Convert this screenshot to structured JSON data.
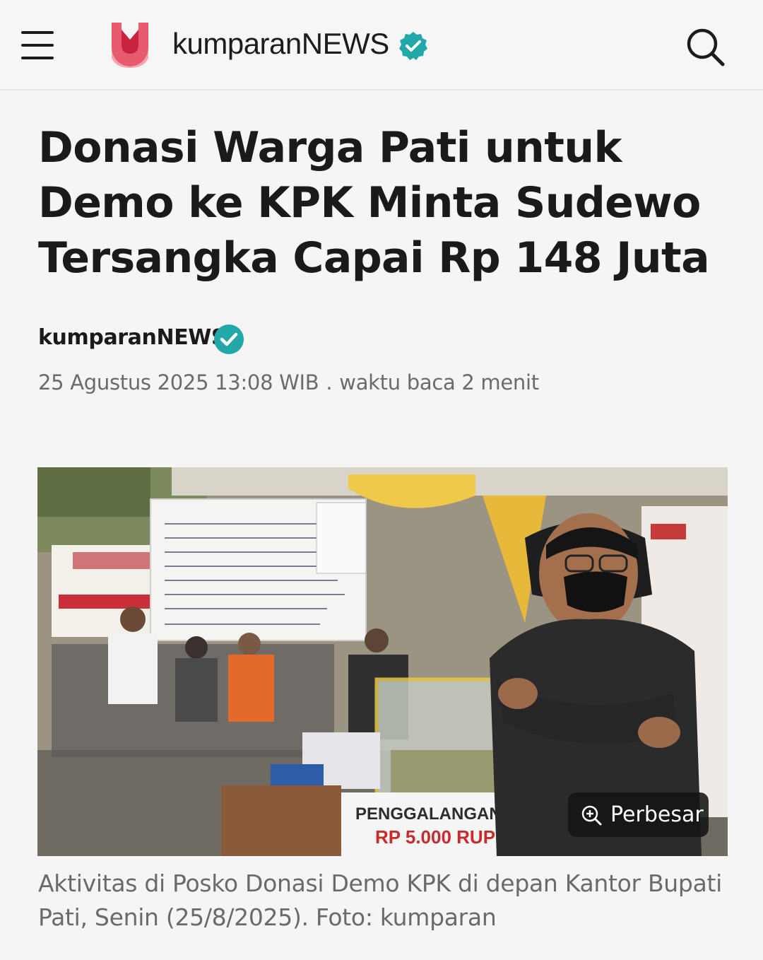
{
  "header": {
    "brand": "kumparanNEWS",
    "colors": {
      "logo": "#e85a6d",
      "verified": "#22a8a8"
    }
  },
  "article": {
    "title": "Donasi Warga Pati untuk Demo ke KPK Minta Sudewo Tersangka Capai Rp 148 Juta",
    "author": "kumparanNEWS",
    "date": "25 Agustus 2025 13:08 WIB",
    "separator": ".",
    "read_time": "waktu baca 2 menit"
  },
  "photo": {
    "enlarge_label": "Perbesar",
    "caption": "Aktivitas di Posko Donasi Demo KPK di depan Kantor Bupati Pati, Senin (25/8/2025). Foto: kumparan"
  }
}
